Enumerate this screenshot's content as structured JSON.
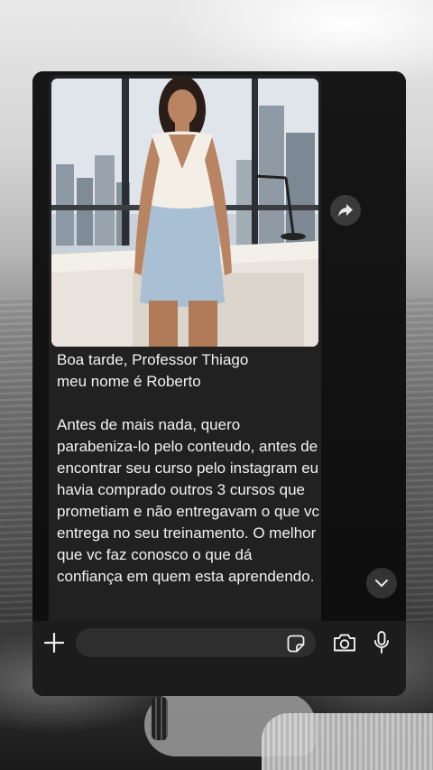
{
  "chat": {
    "message": {
      "image_alt": "Photo of a woman in a white top and light blue skirt leaning on a desk by a city-view window",
      "text": "Boa tarde, Professor Thiago\nmeu nome é Roberto\n\nAntes de mais nada, quero parabeniza-lo pelo conteudo, antes de encontrar seu curso pelo instagram eu havia comprado outros 3 cursos que prometiam e não entregavam o que vc entrega no seu treinamento. O melhor que vc faz conosco o que dá confiança em quem esta aprendendo."
    },
    "forward_icon": "forward-arrow-icon",
    "scroll_icon": "chevron-down-icon"
  },
  "composer": {
    "input_value": "",
    "placeholder": "",
    "icons": [
      "plus-icon",
      "sticker-icon",
      "camera-icon",
      "microphone-icon"
    ]
  },
  "colors": {
    "bubble": "#212121",
    "chat_bg": "#111111",
    "composer_bg": "#1c1c1c",
    "text": "#f2f2f2"
  }
}
